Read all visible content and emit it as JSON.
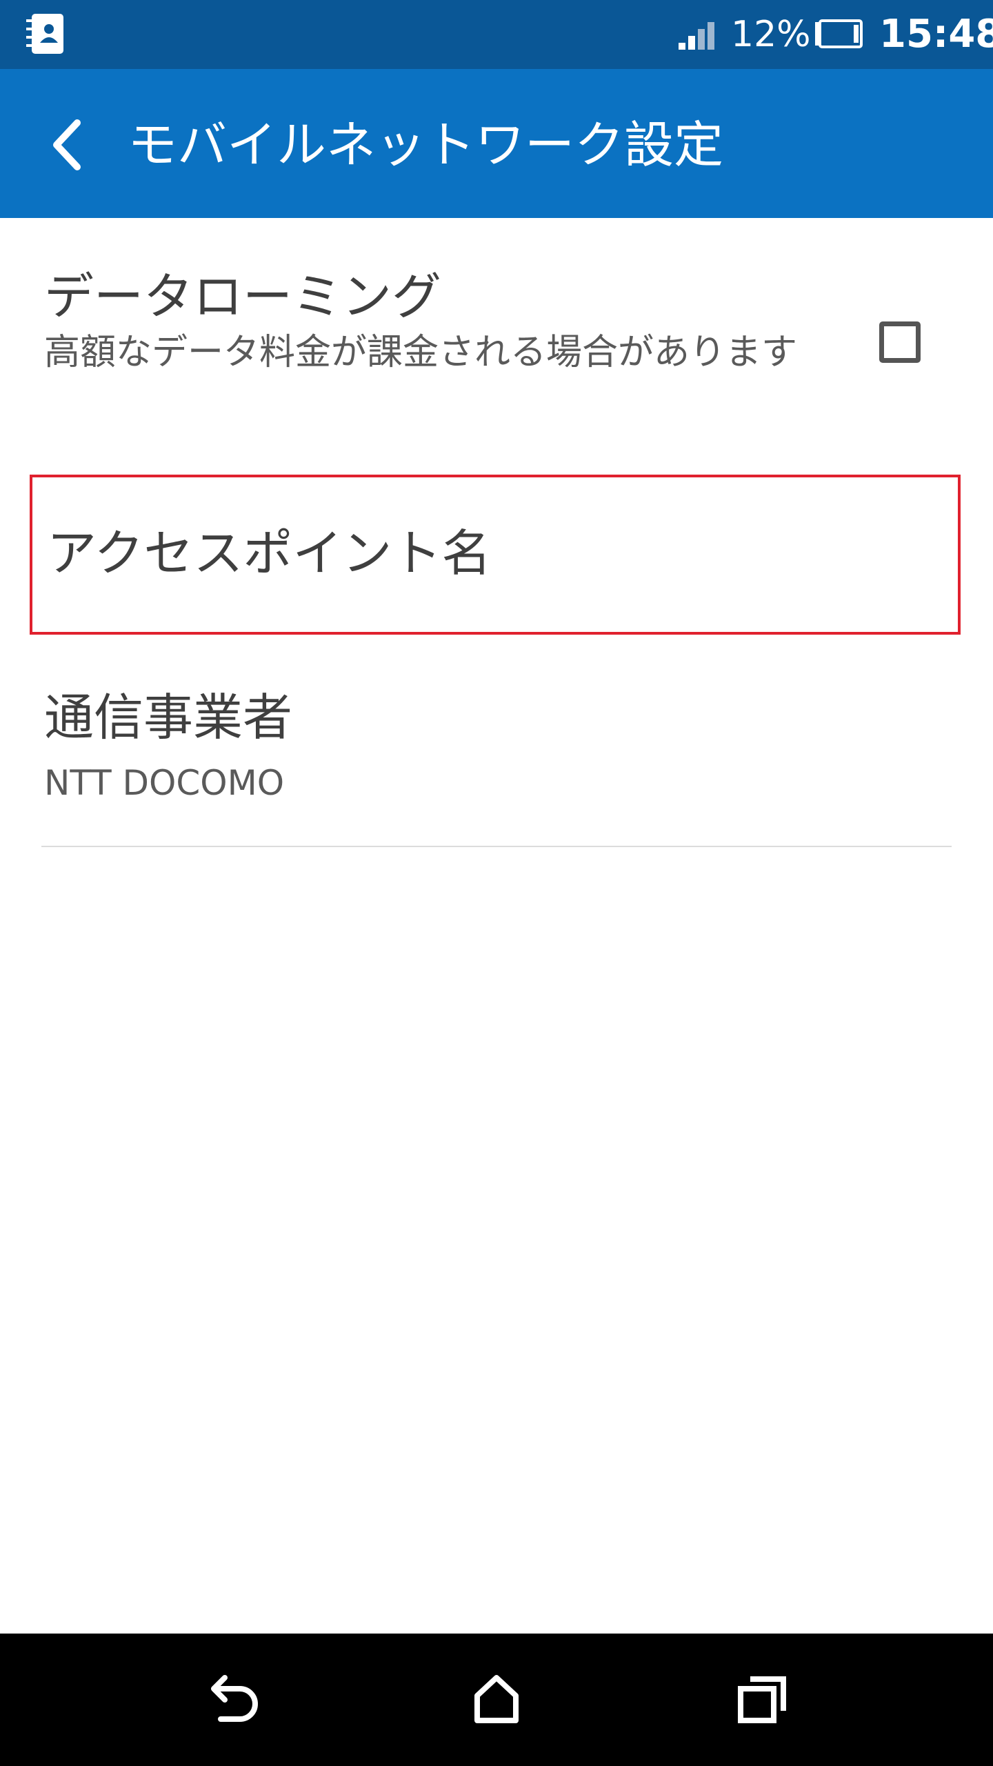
{
  "status_bar": {
    "battery_percent": "12%",
    "time": "15:48",
    "icons": [
      "contacts-icon",
      "signal-icon",
      "battery-icon"
    ]
  },
  "app_bar": {
    "title": "モバイルネットワーク設定",
    "back_icon": "back-arrow-icon",
    "color": "#0b72c2"
  },
  "settings": {
    "data_roaming": {
      "title": "データローミング",
      "summary": "高額なデータ料金が課金される場合があります",
      "checked": false
    },
    "access_point_name": {
      "title": "アクセスポイント名",
      "highlight_color": "#e0212e"
    },
    "carrier": {
      "title": "通信事業者",
      "value": "NTT DOCOMO"
    }
  },
  "nav_bar": {
    "icons": [
      "back-icon",
      "home-icon",
      "recent-apps-icon"
    ]
  }
}
